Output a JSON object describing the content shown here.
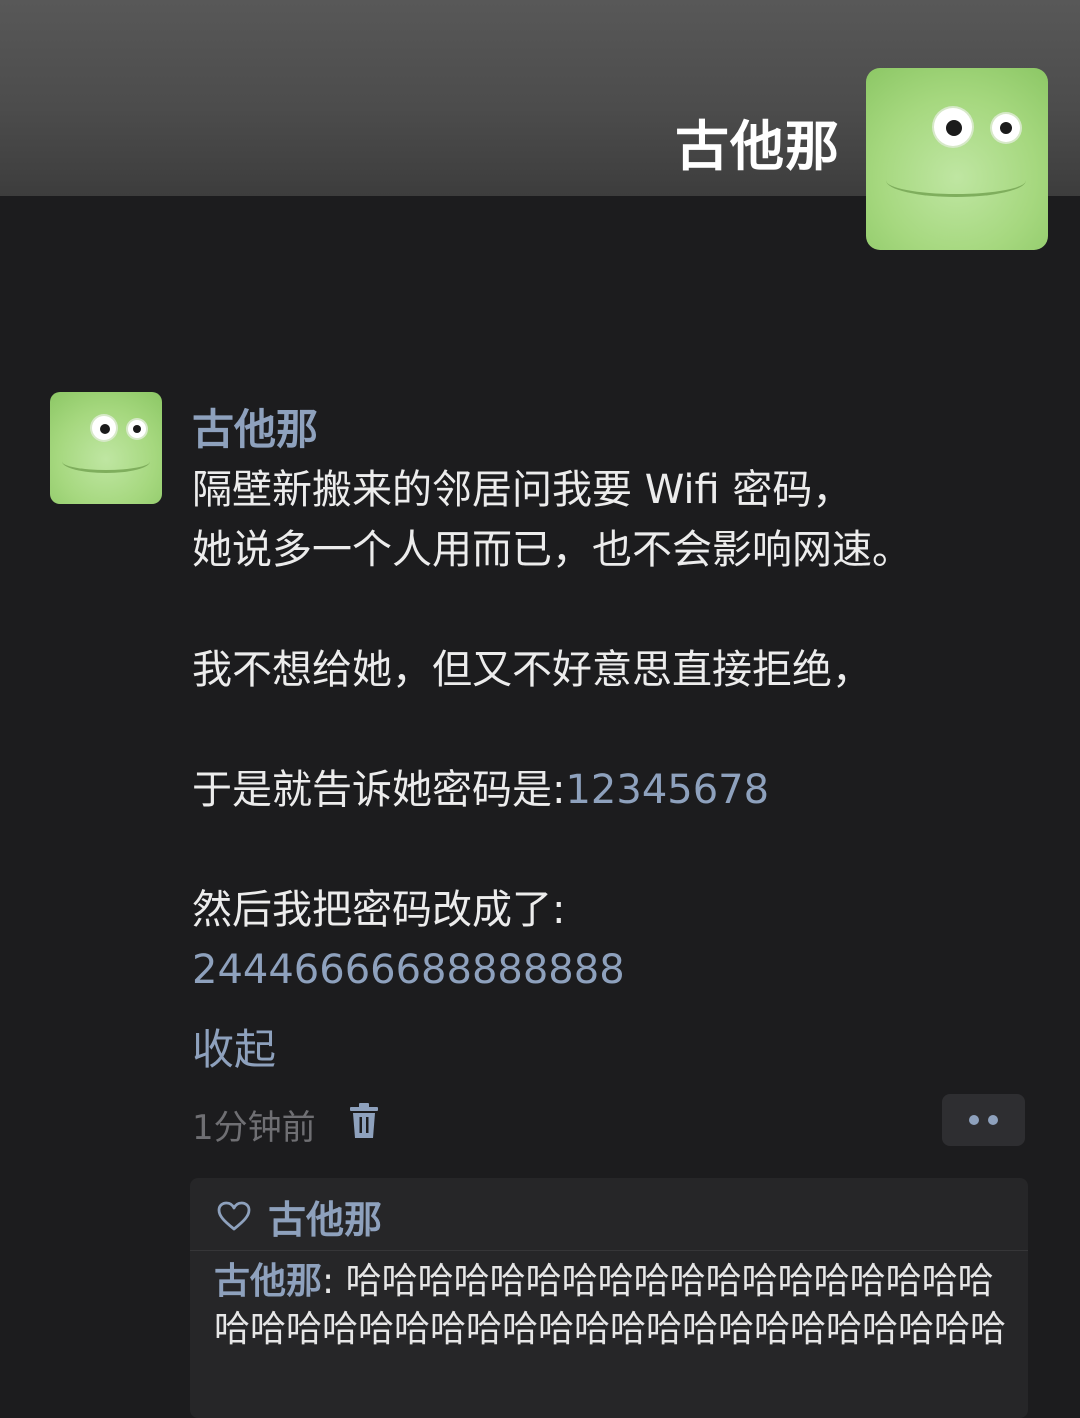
{
  "cover": {
    "name": "古他那"
  },
  "post": {
    "author": "古他那",
    "lines": [
      "隔壁新搬来的邻居问我要 Wifi 密码，",
      "她说多一个人用而已，也不会影响网速。",
      "",
      "我不想给她，但又不好意思直接拒绝，",
      "",
      "于是就告诉她密码是:",
      "",
      "然后我把密码改成了:"
    ],
    "first_password": "12345678",
    "second_password": "24446666688888888",
    "collapse_label": "收起",
    "timestamp": "1分钟前"
  },
  "likes": {
    "names": "古他那"
  },
  "comment": {
    "author": "古他那",
    "separator": ": ",
    "text": "哈哈哈哈哈哈哈哈哈哈哈哈哈哈哈哈哈哈哈哈哈哈哈哈哈哈哈哈哈哈哈哈哈哈哈哈哈哈哈哈"
  },
  "colors": {
    "link": "#8ea1bd",
    "background": "#1c1c1e",
    "avatar_green": "#a6d87f"
  },
  "icons": [
    "trash-icon",
    "more-dots-icon",
    "heart-icon"
  ]
}
